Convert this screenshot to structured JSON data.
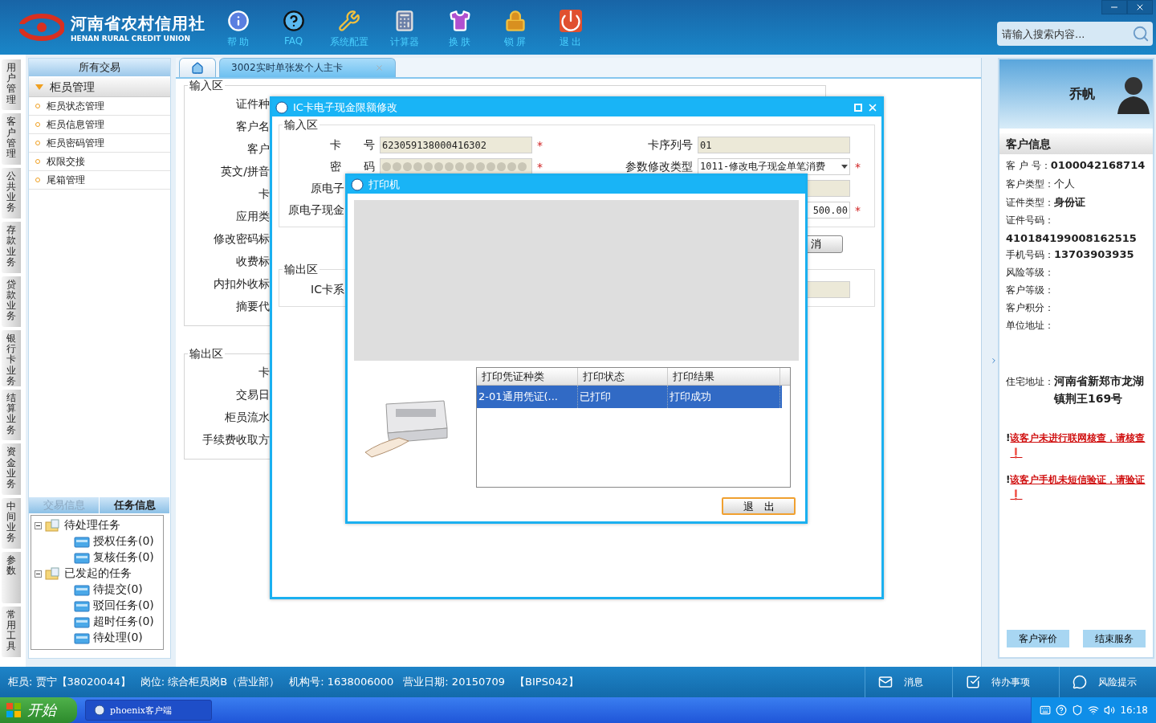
{
  "header": {
    "logo_cn": "河南省农村信用社",
    "logo_en": "HENAN RURAL CREDIT UNION",
    "search": {
      "placeholder": "请输入搜索内容..."
    },
    "toolbar": [
      {
        "label": "帮 助",
        "kind": "info"
      },
      {
        "label": "FAQ",
        "kind": "help"
      },
      {
        "label": "系统配置",
        "kind": "tools"
      },
      {
        "label": "计算器",
        "kind": "calculator"
      },
      {
        "label": "换 肤",
        "kind": "shirt"
      },
      {
        "label": "锁 屏",
        "kind": "lock"
      },
      {
        "label": "退 出",
        "kind": "power"
      }
    ]
  },
  "side_tabs": [
    "用户管理",
    "客户管理",
    "公共业务",
    "存款业务",
    "贷款业务",
    "银行卡业务",
    "结算业务",
    "资金业务",
    "中间业务",
    "参数",
    "常用工具"
  ],
  "nav": {
    "title": "所有交易",
    "groups": [
      {
        "label": "柜员管理",
        "expanded": true,
        "items": [
          "柜员状态管理",
          "柜员信息管理",
          "柜员密码管理",
          "权限交接",
          "尾箱管理"
        ]
      }
    ]
  },
  "info_tabs": [
    {
      "label": "交易信息",
      "selected": false
    },
    {
      "label": "任务信息",
      "selected": true
    }
  ],
  "task_tree": [
    {
      "label": "待处理任务",
      "expanded": true,
      "children": [
        {
          "label": "授权任务(0)"
        },
        {
          "label": "复核任务(0)"
        }
      ]
    },
    {
      "label": "已发起的任务",
      "expanded": true,
      "children": [
        {
          "label": "待提交(0)"
        },
        {
          "label": "驳回任务(0)"
        },
        {
          "label": "超时任务(0)"
        },
        {
          "label": "待处理(0)"
        }
      ]
    }
  ],
  "doc_tabs": [
    {
      "kind": "home",
      "selected": false
    },
    {
      "kind": "page",
      "label": "3002实时单张发个人主卡",
      "selected": true
    }
  ],
  "form": {
    "input_title": "输入区",
    "input_labels": [
      "证件种",
      "客户名",
      "客户",
      "英文/拼音",
      "卡",
      "应用类",
      "修改密码标",
      "收费标",
      "内扣外收标",
      "摘要代"
    ],
    "output_title": "输出区",
    "output_labels": [
      "卡",
      "交易日",
      "柜员流水",
      "手续费收取方"
    ]
  },
  "ic_dialog": {
    "title": "IC卡电子现金限额修改",
    "input_title": "输入区",
    "left_fields": [
      {
        "kind": "text",
        "label": "卡　　号",
        "value": "623059138000416302",
        "mark": "*"
      },
      {
        "kind": "password",
        "label": "密　　码",
        "mark": "*"
      },
      {
        "kind": "cut",
        "label": "原电子"
      },
      {
        "kind": "cut",
        "label": "原电子现金"
      }
    ],
    "right_fields": [
      {
        "kind": "text",
        "label": "卡序列号",
        "value": "01"
      },
      {
        "kind": "select",
        "label": "参数修改类型",
        "value": "1011-修改电子现金单笔消费",
        "mark": "*"
      },
      {
        "kind": "blank"
      },
      {
        "kind": "amount",
        "value": "500.00",
        "mark": "*"
      }
    ],
    "cancel_button": "消",
    "output_title": "输出区",
    "output_label": "IC卡系"
  },
  "printer_dialog": {
    "title": "打印机",
    "columns": [
      "打印凭证种类",
      "打印状态",
      "打印结果"
    ],
    "rows": [
      {
        "cells": [
          "2-01通用凭证(...",
          "已打印",
          "打印成功"
        ],
        "selected": true
      }
    ],
    "exit_button": "退　出"
  },
  "customer": {
    "name": "乔帆",
    "section": "客户信息",
    "fields": [
      {
        "label": "客 户 号：",
        "value": "0100042168714",
        "bold": true,
        "block": false
      },
      {
        "label": "客户类型：",
        "value": "个人",
        "bold": false,
        "block": false
      },
      {
        "label": "证件类型：",
        "value": "身份证",
        "bold": true,
        "block": false
      },
      {
        "label": "证件号码：",
        "value": "410184199008162515",
        "bold": true,
        "block": true
      },
      {
        "label": "手机号码：",
        "value": "13703903935",
        "bold": true,
        "block": false
      },
      {
        "label": "风险等级："
      },
      {
        "label": "客户等级："
      },
      {
        "label": "客户积分："
      },
      {
        "label": "单位地址："
      }
    ],
    "address": {
      "label": "住宅地址：",
      "value": "河南省新郑市龙湖镇荆王169号"
    },
    "warnings": [
      {
        "mark": "!",
        "text": "该客户未进行联网核查，请核查❗"
      },
      {
        "mark": "!",
        "text": "该客户手机未短信验证，请验证❗"
      }
    ],
    "buttons": [
      "客户评价",
      "结束服务"
    ]
  },
  "status": {
    "segments": [
      "柜员: 贾宁【38020044】",
      "岗位: 综合柜员岗B（营业部）",
      "机构号: 1638006000",
      "营业日期: 20150709",
      "【BIPS042】"
    ],
    "buttons": [
      {
        "label": "消息",
        "kind": "mail"
      },
      {
        "label": "待办事项",
        "kind": "check"
      },
      {
        "label": "风险提示",
        "kind": "chat"
      }
    ]
  },
  "taskbar": {
    "start": "开始",
    "tasks": [
      "phoenix客户端"
    ],
    "clock": "16:18"
  }
}
